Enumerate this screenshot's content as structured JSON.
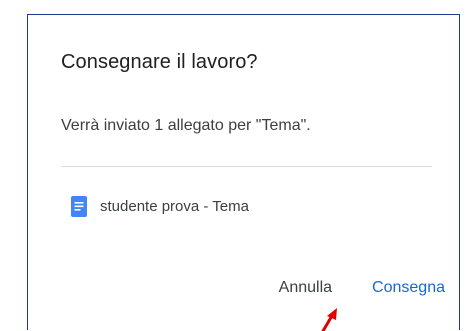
{
  "dialog": {
    "title": "Consegnare il lavoro?",
    "message": "Verrà inviato 1 allegato per \"Tema\".",
    "attachment": {
      "icon": "google-docs-icon",
      "label": "studente prova - Tema"
    },
    "actions": {
      "cancel_label": "Annulla",
      "submit_label": "Consegna"
    }
  },
  "colors": {
    "accent": "#1967d2",
    "doc_icon": "#4285f4",
    "annotation_arrow": "#e00000",
    "border": "#1f3a93"
  }
}
